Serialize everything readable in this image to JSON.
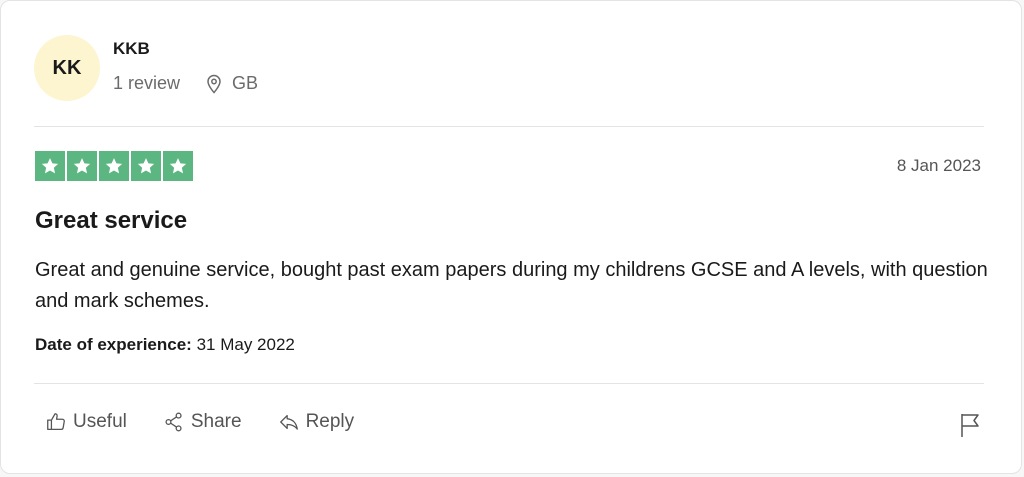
{
  "reviewer": {
    "initials": "KK",
    "name": "KKB",
    "review_count": "1 review",
    "location": "GB"
  },
  "review": {
    "rating": 5,
    "date": "8 Jan 2023",
    "title": "Great service",
    "body": "Great and genuine service, bought past exam papers during my childrens GCSE and A levels, with question and mark schemes.",
    "experience_label": "Date of experience:",
    "experience_date": "31 May 2022"
  },
  "actions": {
    "useful": "Useful",
    "share": "Share",
    "reply": "Reply"
  },
  "colors": {
    "star_bg": "#5cb682",
    "avatar_bg": "#fdf5cf"
  },
  "icons": [
    "location-pin-icon",
    "thumbs-up-icon",
    "share-icon",
    "reply-icon",
    "flag-icon",
    "star-icon"
  ]
}
